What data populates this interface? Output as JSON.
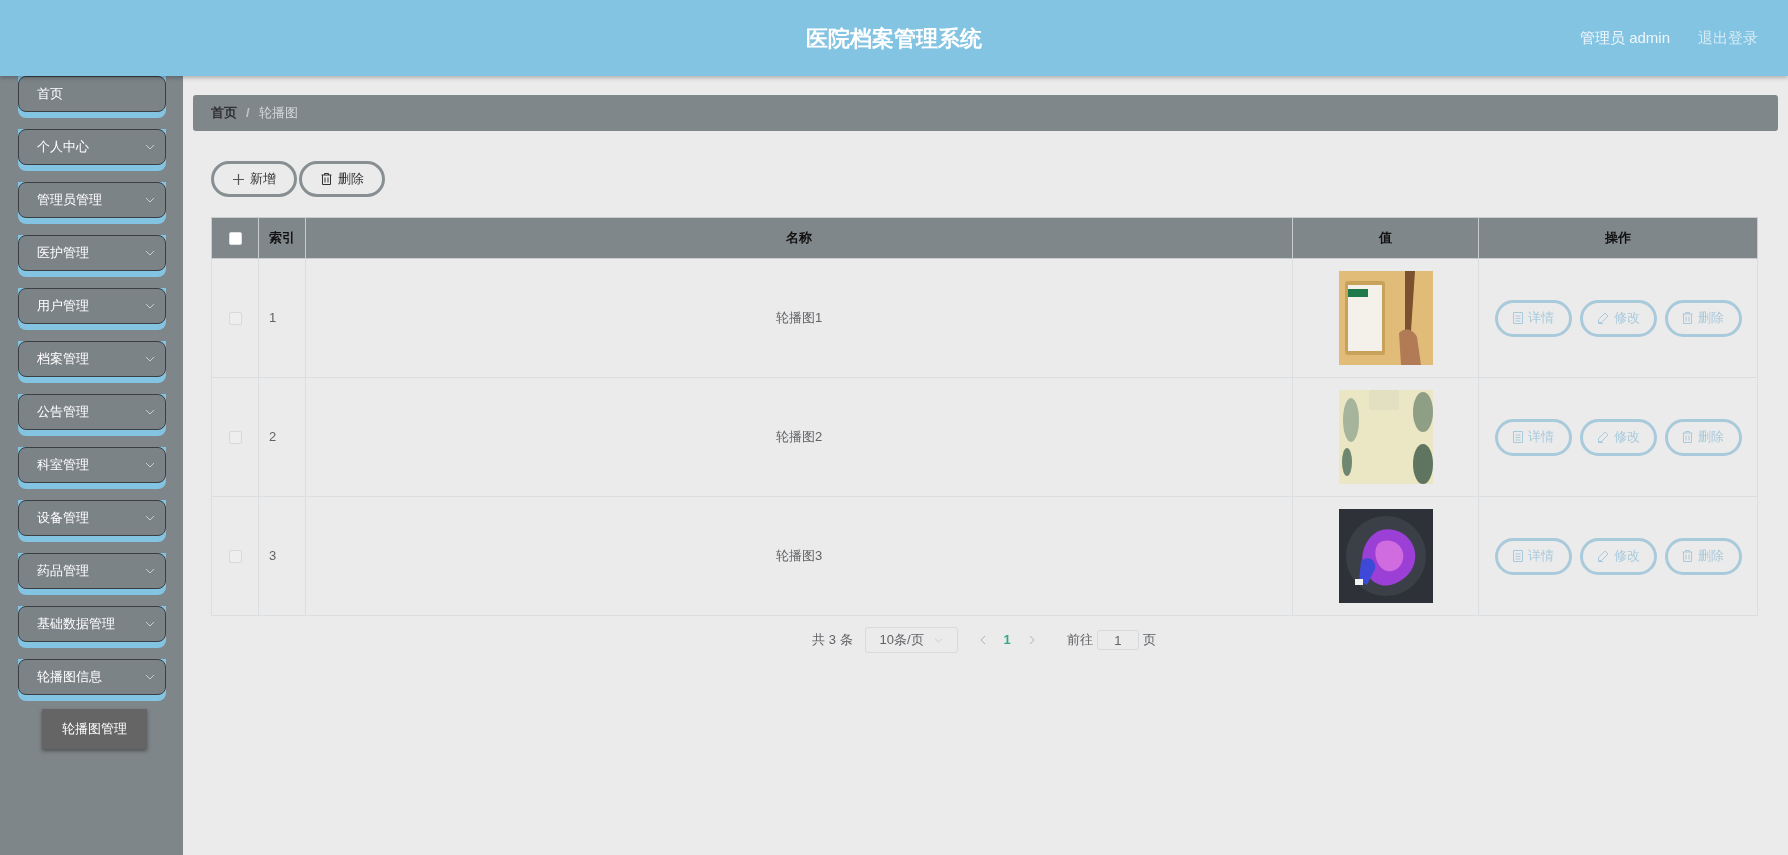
{
  "header": {
    "title": "医院档案管理系统",
    "user": "管理员 admin",
    "logout": "退出登录"
  },
  "sidebar": {
    "items": [
      {
        "label": "首页",
        "expandable": false
      },
      {
        "label": "个人中心",
        "expandable": true
      },
      {
        "label": "管理员管理",
        "expandable": true
      },
      {
        "label": "医护管理",
        "expandable": true
      },
      {
        "label": "用户管理",
        "expandable": true
      },
      {
        "label": "档案管理",
        "expandable": true
      },
      {
        "label": "公告管理",
        "expandable": true
      },
      {
        "label": "科室管理",
        "expandable": true
      },
      {
        "label": "设备管理",
        "expandable": true
      },
      {
        "label": "药品管理",
        "expandable": true
      },
      {
        "label": "基础数据管理",
        "expandable": true
      },
      {
        "label": "轮播图信息",
        "expandable": true,
        "children": [
          {
            "label": "轮播图管理",
            "selected": true
          }
        ]
      }
    ]
  },
  "breadcrumb": [
    "首页",
    "轮播图"
  ],
  "breadcrumb_separator": "/",
  "toolbar": [
    {
      "kind": "add",
      "label": "新增"
    },
    {
      "kind": "delete",
      "label": "删除"
    }
  ],
  "table": {
    "select_all": {
      "checked": false
    },
    "columns": [
      "索引",
      "名称",
      "值",
      "操作"
    ],
    "rows": [
      {
        "checked": false,
        "index": "1",
        "name": "轮播图1",
        "value": {
          "kind": "picture"
        },
        "actions": [
          {
            "kind": "detail",
            "label": "详情"
          },
          {
            "kind": "edit",
            "label": "修改"
          },
          {
            "kind": "delete",
            "label": "删除"
          }
        ]
      },
      {
        "checked": false,
        "index": "2",
        "name": "轮播图2",
        "value": {
          "kind": "picture"
        },
        "actions": [
          {
            "kind": "detail",
            "label": "详情"
          },
          {
            "kind": "edit",
            "label": "修改"
          },
          {
            "kind": "delete",
            "label": "删除"
          }
        ]
      },
      {
        "checked": false,
        "index": "3",
        "name": "轮播图3",
        "value": {
          "kind": "picture"
        },
        "actions": [
          {
            "kind": "detail",
            "label": "详情"
          },
          {
            "kind": "edit",
            "label": "修改"
          },
          {
            "kind": "delete",
            "label": "删除"
          }
        ]
      }
    ]
  },
  "pagination": {
    "total": "共 3 条",
    "page_size": "10条/页",
    "pages": [
      {
        "label": "1",
        "selected": true
      }
    ],
    "goto_label": "前往",
    "goto_value": "1",
    "page_suffix": "页"
  }
}
